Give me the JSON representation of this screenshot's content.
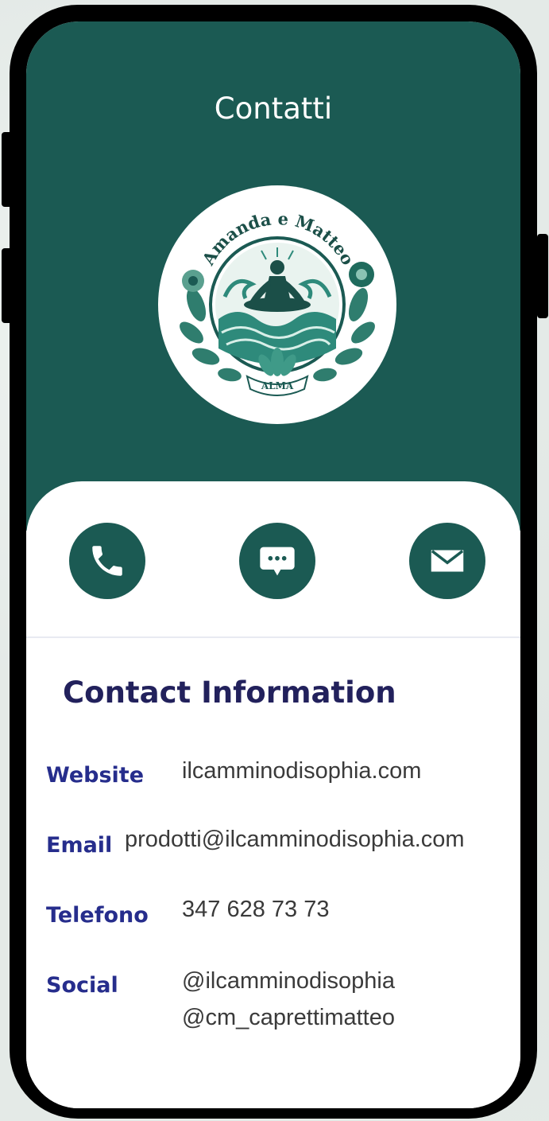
{
  "header": {
    "title": "Contatti",
    "logo": {
      "top_text": "Amanda e Matteo",
      "bottom_text": "ALMA"
    }
  },
  "actions": [
    {
      "name": "phone",
      "icon": "phone-icon"
    },
    {
      "name": "message",
      "icon": "chat-bubble-icon"
    },
    {
      "name": "email",
      "icon": "envelope-icon"
    }
  ],
  "contact": {
    "section_title": "Contact Information",
    "website_label": "Website",
    "website_value": "ilcamminodisophia.com",
    "email_label": "Email",
    "email_value": "prodotti@ilcamminodisophia.com",
    "phone_label": "Telefono",
    "phone_value": "347 628 73 73",
    "social_label": "Social",
    "social_value_1": "@ilcamminodisophia",
    "social_value_2": "@cm_caprettimatteo"
  },
  "colors": {
    "brand": "#1b5a53",
    "label": "#262d8c",
    "heading": "#22215c",
    "text": "#3a3a3a"
  }
}
